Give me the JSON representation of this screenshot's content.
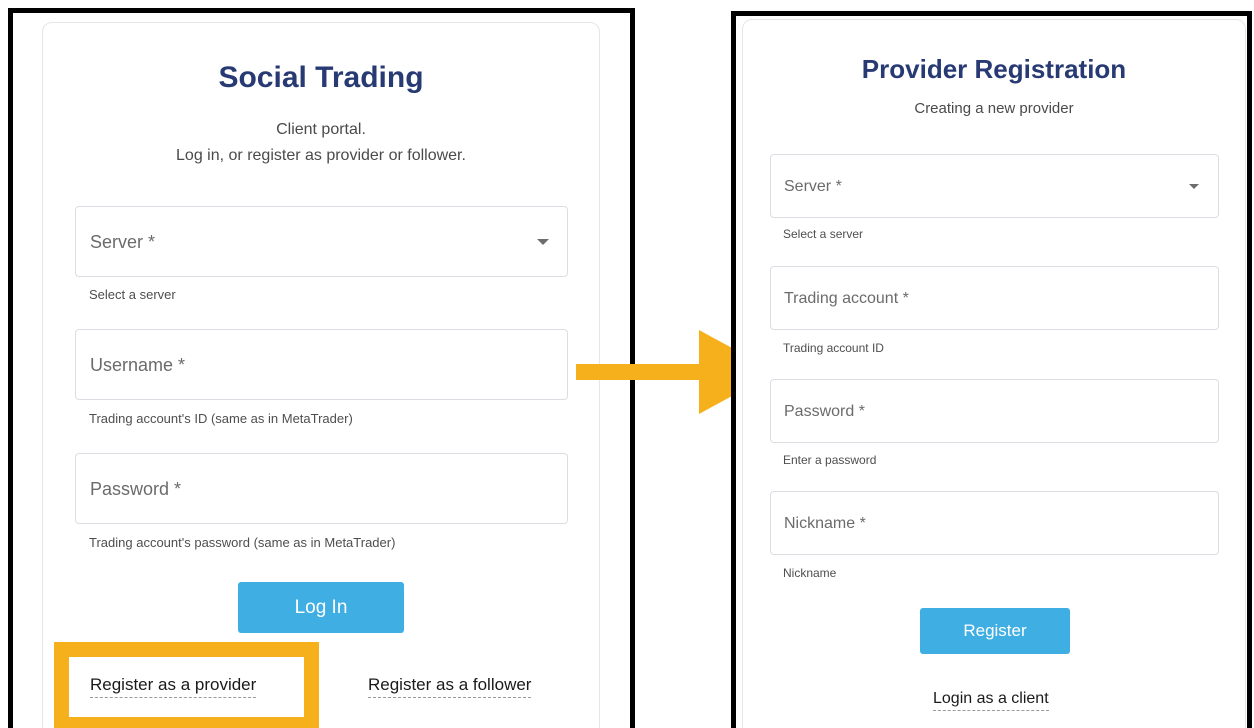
{
  "login_panel": {
    "title": "Social Trading",
    "subtitle_line1": "Client portal.",
    "subtitle_line2": "Log in, or register as provider or follower.",
    "server_field": {
      "label": "Server *",
      "helper": "Select a server"
    },
    "username_field": {
      "label": "Username *",
      "helper": "Trading account's ID (same as in MetaTrader)"
    },
    "password_field": {
      "label": "Password *",
      "helper": "Trading account's password (same as in MetaTrader)"
    },
    "login_button": "Log In",
    "register_provider_link": "Register as a provider",
    "register_follower_link": "Register as a follower"
  },
  "registration_panel": {
    "title": "Provider Registration",
    "subtitle": "Creating a new provider",
    "server_field": {
      "label": "Server *",
      "helper": "Select a server"
    },
    "trading_account_field": {
      "label": "Trading account *",
      "helper": "Trading account ID"
    },
    "password_field": {
      "label": "Password *",
      "helper": "Enter a password"
    },
    "nickname_field": {
      "label": "Nickname *",
      "helper": "Nickname"
    },
    "register_button": "Register",
    "login_client_link": "Login as a client"
  },
  "colors": {
    "title": "#283a73",
    "button": "#3faee2",
    "highlight": "#f5b01c",
    "arrow": "#f5b01c",
    "frame": "#000000"
  },
  "icons": {
    "dropdown": "chevron-down-icon",
    "arrow": "arrow-right-icon"
  }
}
